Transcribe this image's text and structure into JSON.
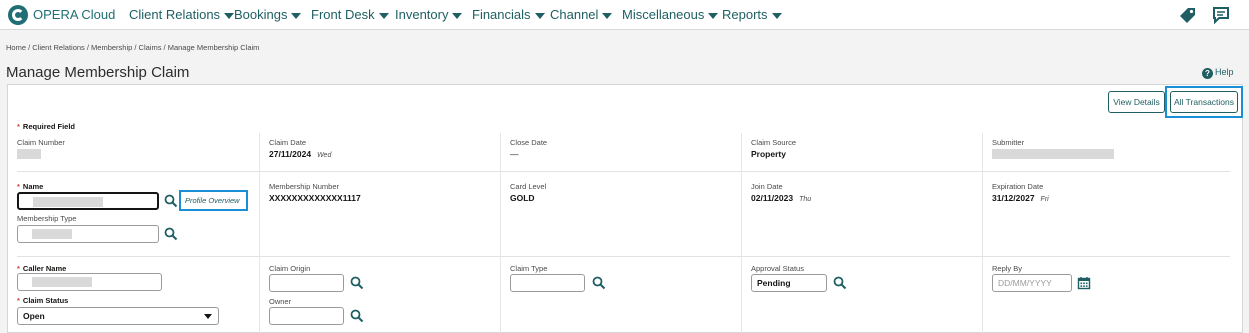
{
  "app": {
    "brand": "OPERA Cloud"
  },
  "nav": [
    {
      "label": "Client Relations"
    },
    {
      "label": "Bookings"
    },
    {
      "label": "Front Desk"
    },
    {
      "label": "Inventory"
    },
    {
      "label": "Financials"
    },
    {
      "label": "Channel"
    },
    {
      "label": "Miscellaneous"
    },
    {
      "label": "Reports"
    }
  ],
  "breadcrumb": "Home / Client Relations / Membership / Claims / Manage Membership Claim",
  "page": {
    "title": "Manage Membership Claim",
    "help": "Help"
  },
  "actions": {
    "view_details": "View Details",
    "all_transactions": "All Transactions"
  },
  "required_note": "Required Field",
  "row1": {
    "claim_number_label": "Claim Number",
    "claim_date_label": "Claim Date",
    "claim_date": "27/11/2024",
    "claim_date_day": "Wed",
    "close_date_label": "Close Date",
    "close_date": "—",
    "claim_source_label": "Claim Source",
    "claim_source": "Property",
    "submitter_label": "Submitter"
  },
  "row2": {
    "name_label": "Name",
    "profile_overview": "Profile Overview",
    "membership_type_label": "Membership Type",
    "membership_number_label": "Membership Number",
    "membership_number": "XXXXXXXXXXXXX1117",
    "card_level_label": "Card Level",
    "card_level": "GOLD",
    "join_date_label": "Join Date",
    "join_date": "02/11/2023",
    "join_date_day": "Thu",
    "expiration_date_label": "Expiration Date",
    "expiration_date": "31/12/2027",
    "expiration_date_day": "Fri"
  },
  "row3": {
    "caller_name_label": "Caller Name",
    "claim_status_label": "Claim Status",
    "claim_status": "Open",
    "claim_origin_label": "Claim Origin",
    "owner_label": "Owner",
    "claim_type_label": "Claim Type",
    "approval_status_label": "Approval Status",
    "approval_status": "Pending",
    "reply_by_label": "Reply By",
    "reply_by_placeholder": "DD/MM/YYYY"
  },
  "colors": {
    "accent": "#1f5f63",
    "highlight": "#1b8fd6",
    "required": "#c74634"
  },
  "icons": [
    "opera-logo-icon",
    "caret-down-icon",
    "tag-icon",
    "chat-icon",
    "help-icon",
    "search-icon",
    "calendar-icon"
  ]
}
